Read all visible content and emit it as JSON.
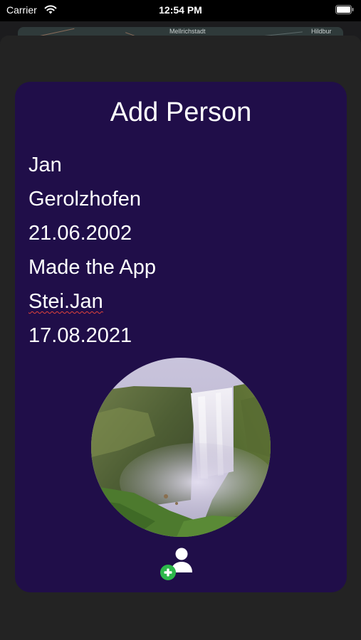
{
  "status_bar": {
    "carrier": "Carrier",
    "time": "12:54 PM",
    "wifi_icon": "wifi-icon",
    "battery_icon": "battery-icon"
  },
  "background_map": {
    "labels": [
      "Mellrichstadt",
      "Hildbur"
    ]
  },
  "card": {
    "title": "Add Person",
    "fields": {
      "name": "Jan",
      "place": "Gerolzhofen",
      "birth_date": "21.06.2002",
      "description": "Made the App",
      "author": "Stei.Jan",
      "date": "17.08.2021"
    },
    "photo_icon": "waterfall-photo",
    "add_button_icon": "add-person-icon",
    "colors": {
      "card_background": "#200e49",
      "sheet_background": "#232323",
      "add_badge": "#2db84a"
    }
  }
}
